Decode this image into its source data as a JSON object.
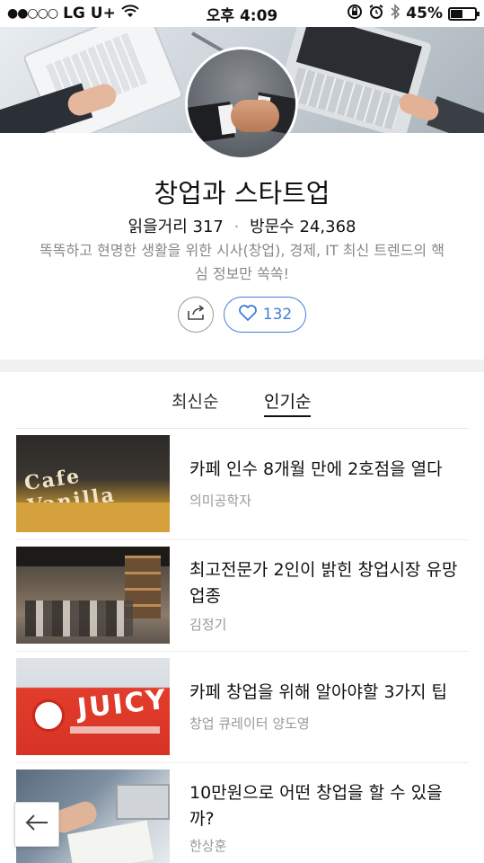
{
  "status_bar": {
    "signal": "●●○○○",
    "carrier": "LG U+",
    "time": "오후 4:09",
    "battery": "45%",
    "battery_level": 0.45
  },
  "profile": {
    "title": "창업과 스타트업",
    "reads_label": "읽을거리",
    "reads_count": "317",
    "visits_label": "방문수",
    "visits_count": "24,368",
    "description": "똑똑하고 현명한 생활을 위한 시사(창업), 경제, IT 최신 트렌드의 핵심 정보만 쏙쏙!",
    "like_count": "132"
  },
  "tabs": [
    {
      "label": "최신순",
      "active": false
    },
    {
      "label": "인기순",
      "active": true
    }
  ],
  "articles": [
    {
      "title": "카페 인수 8개월 만에 2호점을 열다",
      "author": "의미공학자"
    },
    {
      "title": "최고전문가 2인이 밝힌 창업시장 유망 업종",
      "author": "김정기"
    },
    {
      "title": "카페 창업을 위해 알아야할 3가지 팁",
      "author": "창업 큐레이터 양도영"
    },
    {
      "title": "10만원으로 어떤 창업을 할 수 있을까?",
      "author": "한상훈"
    }
  ],
  "thumbnails": {
    "cafe_sign_text": "Cafe Vanilla",
    "juicy_sign_text": "JUICY"
  },
  "colors": {
    "accent": "#3f7fd9",
    "muted_text": "#888888"
  }
}
